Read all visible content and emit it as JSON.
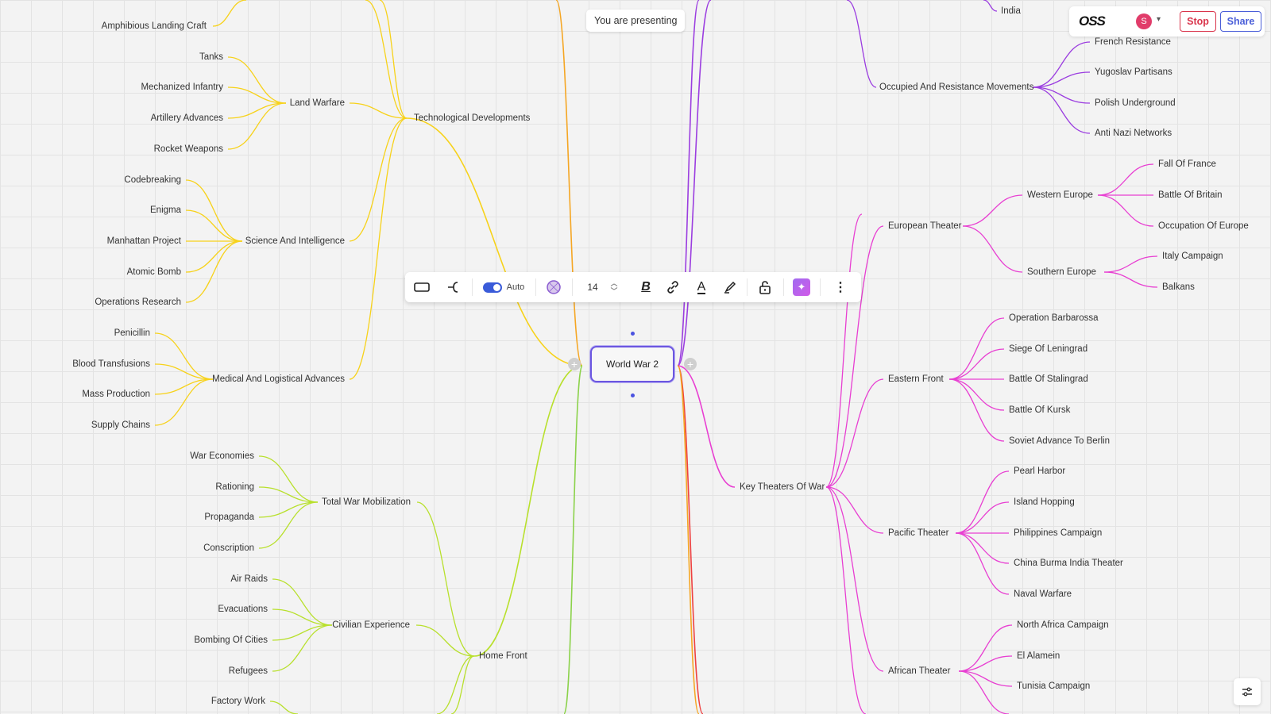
{
  "presenting_text": "You are presenting",
  "header": {
    "logo_text": "OSS",
    "avatar_initial": "S",
    "stop_label": "Stop",
    "share_label": "Share"
  },
  "toolbar": {
    "toggle_label": "Auto",
    "font_size": "14"
  },
  "central": "World War 2",
  "colors": {
    "yellow": "#f7d21a",
    "lime": "#b8e02c",
    "green": "#8bd24a",
    "orange": "#f5a623",
    "purple": "#9b3de0",
    "magenta": "#e83fd2",
    "red": "#ee4040",
    "accent": "#6b56e0"
  },
  "nodes": {
    "technological_developments": "Technological Developments",
    "land_warfare": "Land Warfare",
    "amphibious_landing_craft": "Amphibious Landing Craft",
    "tanks": "Tanks",
    "mechanized_infantry": "Mechanized Infantry",
    "artillery_advances": "Artillery Advances",
    "rocket_weapons": "Rocket Weapons",
    "science_and_intelligence": "Science And Intelligence",
    "codebreaking": "Codebreaking",
    "enigma": "Enigma",
    "manhattan_project": "Manhattan Project",
    "atomic_bomb": "Atomic Bomb",
    "operations_research": "Operations Research",
    "medical_logistical": "Medical And Logistical Advances",
    "penicillin": "Penicillin",
    "blood_transfusions": "Blood Transfusions",
    "mass_production": "Mass Production",
    "supply_chains": "Supply Chains",
    "home_front": "Home Front",
    "total_war_mobilization": "Total War Mobilization",
    "war_economies": "War Economies",
    "rationing": "Rationing",
    "propaganda": "Propaganda",
    "conscription": "Conscription",
    "civilian_experience": "Civilian Experience",
    "air_raids": "Air Raids",
    "evacuations": "Evacuations",
    "bombing_of_cities": "Bombing Of Cities",
    "refugees": "Refugees",
    "factory_work": "Factory Work",
    "india": "India",
    "occupied_resistance": "Occupied And Resistance Movements",
    "french_resistance": "French Resistance",
    "yugoslav_partisans": "Yugoslav Partisans",
    "polish_underground": "Polish Underground",
    "anti_nazi_networks": "Anti Nazi Networks",
    "key_theaters": "Key Theaters Of War",
    "european_theater": "European Theater",
    "western_europe": "Western Europe",
    "fall_of_france": "Fall Of France",
    "battle_of_britain": "Battle Of Britain",
    "occupation_of_europe": "Occupation Of Europe",
    "southern_europe": "Southern Europe",
    "italy_campaign": "Italy Campaign",
    "balkans": "Balkans",
    "eastern_front": "Eastern Front",
    "operation_barbarossa": "Operation Barbarossa",
    "siege_of_leningrad": "Siege Of Leningrad",
    "battle_of_stalingrad": "Battle Of Stalingrad",
    "battle_of_kursk": "Battle Of Kursk",
    "soviet_advance": "Soviet Advance To Berlin",
    "pacific_theater": "Pacific Theater",
    "pearl_harbor": "Pearl Harbor",
    "island_hopping": "Island Hopping",
    "philippines_campaign": "Philippines Campaign",
    "china_burma_india": "China Burma India Theater",
    "naval_warfare": "Naval Warfare",
    "african_theater": "African Theater",
    "north_africa": "North Africa Campaign",
    "el_alamein": "El Alamein",
    "tunisia_campaign": "Tunisia Campaign"
  }
}
